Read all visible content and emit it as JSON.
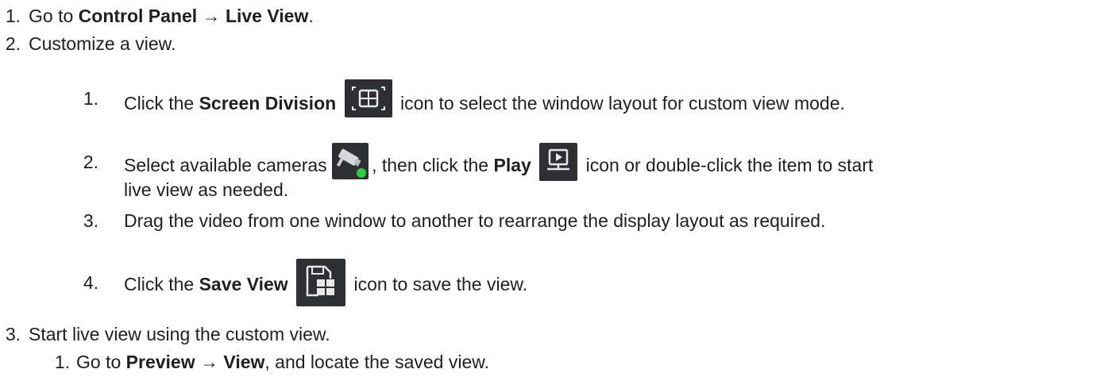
{
  "steps": [
    {
      "num": "1.",
      "prefix": "Go to ",
      "bold1": "Control Panel",
      "arrow": " → ",
      "bold2": "Live View",
      "suffix": "."
    },
    {
      "num": "2.",
      "text": "Customize a view.",
      "substeps": [
        {
          "num": "1.",
          "prefix": "Click the ",
          "bold": "Screen Division",
          "icon": "screen-division-icon",
          "suffix": " icon to select the window layout for custom view mode."
        },
        {
          "num": "2.",
          "prefix": "Select available cameras ",
          "icon1": "camera-online-icon",
          "middle1": ", then click the ",
          "bold": "Play",
          "icon2": "play-monitor-icon",
          "middle2": " icon or double-click the item to start",
          "continuation": "live view as needed."
        },
        {
          "num": "3.",
          "text": "Drag the video from one window to another to rearrange the display layout as required."
        },
        {
          "num": "4.",
          "prefix": "Click the ",
          "bold": "Save View",
          "icon": "save-view-icon",
          "suffix": " icon to save the view."
        }
      ]
    },
    {
      "num": "3.",
      "text": "Start live view using the custom view.",
      "substeps": [
        {
          "num": "1.",
          "prefix": "Go to ",
          "bold1": "Preview",
          "arrow": " → ",
          "bold2": "View",
          "suffix": ", and locate the saved view."
        }
      ]
    }
  ],
  "colors": {
    "text": "#1f1f1f",
    "icon_bg": "#2d2f33",
    "icon_fg": "#e8e8e8",
    "online_dot": "#2ecc40"
  }
}
